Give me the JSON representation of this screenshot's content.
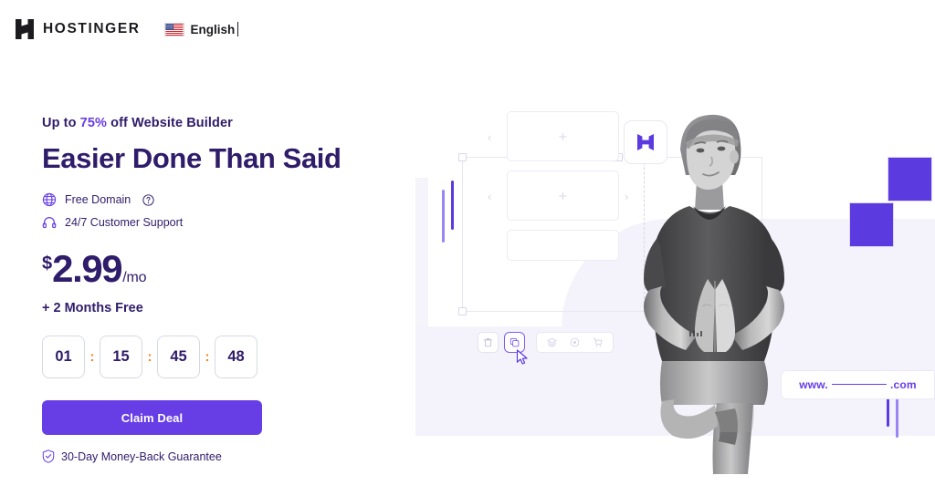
{
  "header": {
    "brand_name": "HOSTINGER",
    "brand_logo_icon": "hostinger-h-logo",
    "language": {
      "flag_icon": "us-flag-icon",
      "label": "English",
      "caret_visible": true
    }
  },
  "promo": {
    "eyebrow_prefix": "Up to ",
    "eyebrow_discount": "75%",
    "eyebrow_suffix": " off Website Builder",
    "headline": "Easier Done Than Said",
    "features": [
      {
        "icon": "globe-icon",
        "label": "Free Domain",
        "help_icon": "question-mark-icon"
      },
      {
        "icon": "headset-icon",
        "label": "24/7 Customer Support",
        "help_icon": null
      }
    ],
    "price": {
      "currency": "$",
      "amount": "2.99",
      "period": "/mo"
    },
    "bonus": "+ 2 Months Free",
    "timer": {
      "days": "01",
      "hours": "15",
      "minutes": "45",
      "seconds": "48",
      "separator": ":"
    },
    "cta_label": "Claim Deal",
    "guarantee": {
      "icon": "shield-check-icon",
      "label": "30-Day Money-Back Guarantee"
    }
  },
  "illustration": {
    "logo_badge_icon": "hostinger-logo-icon",
    "card_placeholder_icon": "plus-icon",
    "nav_prev_icon": "chevron-left-icon",
    "nav_next_icon": "chevron-right-icon",
    "toolbar": [
      {
        "icon": "trash-icon",
        "selected": false
      },
      {
        "icon": "duplicate-icon",
        "selected": true
      },
      {
        "icon": "layers-icon",
        "selected": false
      },
      {
        "icon": "target-icon",
        "selected": false
      },
      {
        "icon": "cart-icon",
        "selected": false
      }
    ],
    "cursor_icon": "mouse-pointer-icon",
    "urlbar": {
      "prefix": "www.",
      "suffix": ".com"
    },
    "person_photo": "woman-in-prayer-pose-grayscale"
  },
  "colors": {
    "brand_purple": "#673de6",
    "deep_purple": "#2f1c6a",
    "timer_separator": "#f5821f",
    "lavender_panel": "#f4f3fb",
    "square_purple": "#5b3ae0"
  }
}
